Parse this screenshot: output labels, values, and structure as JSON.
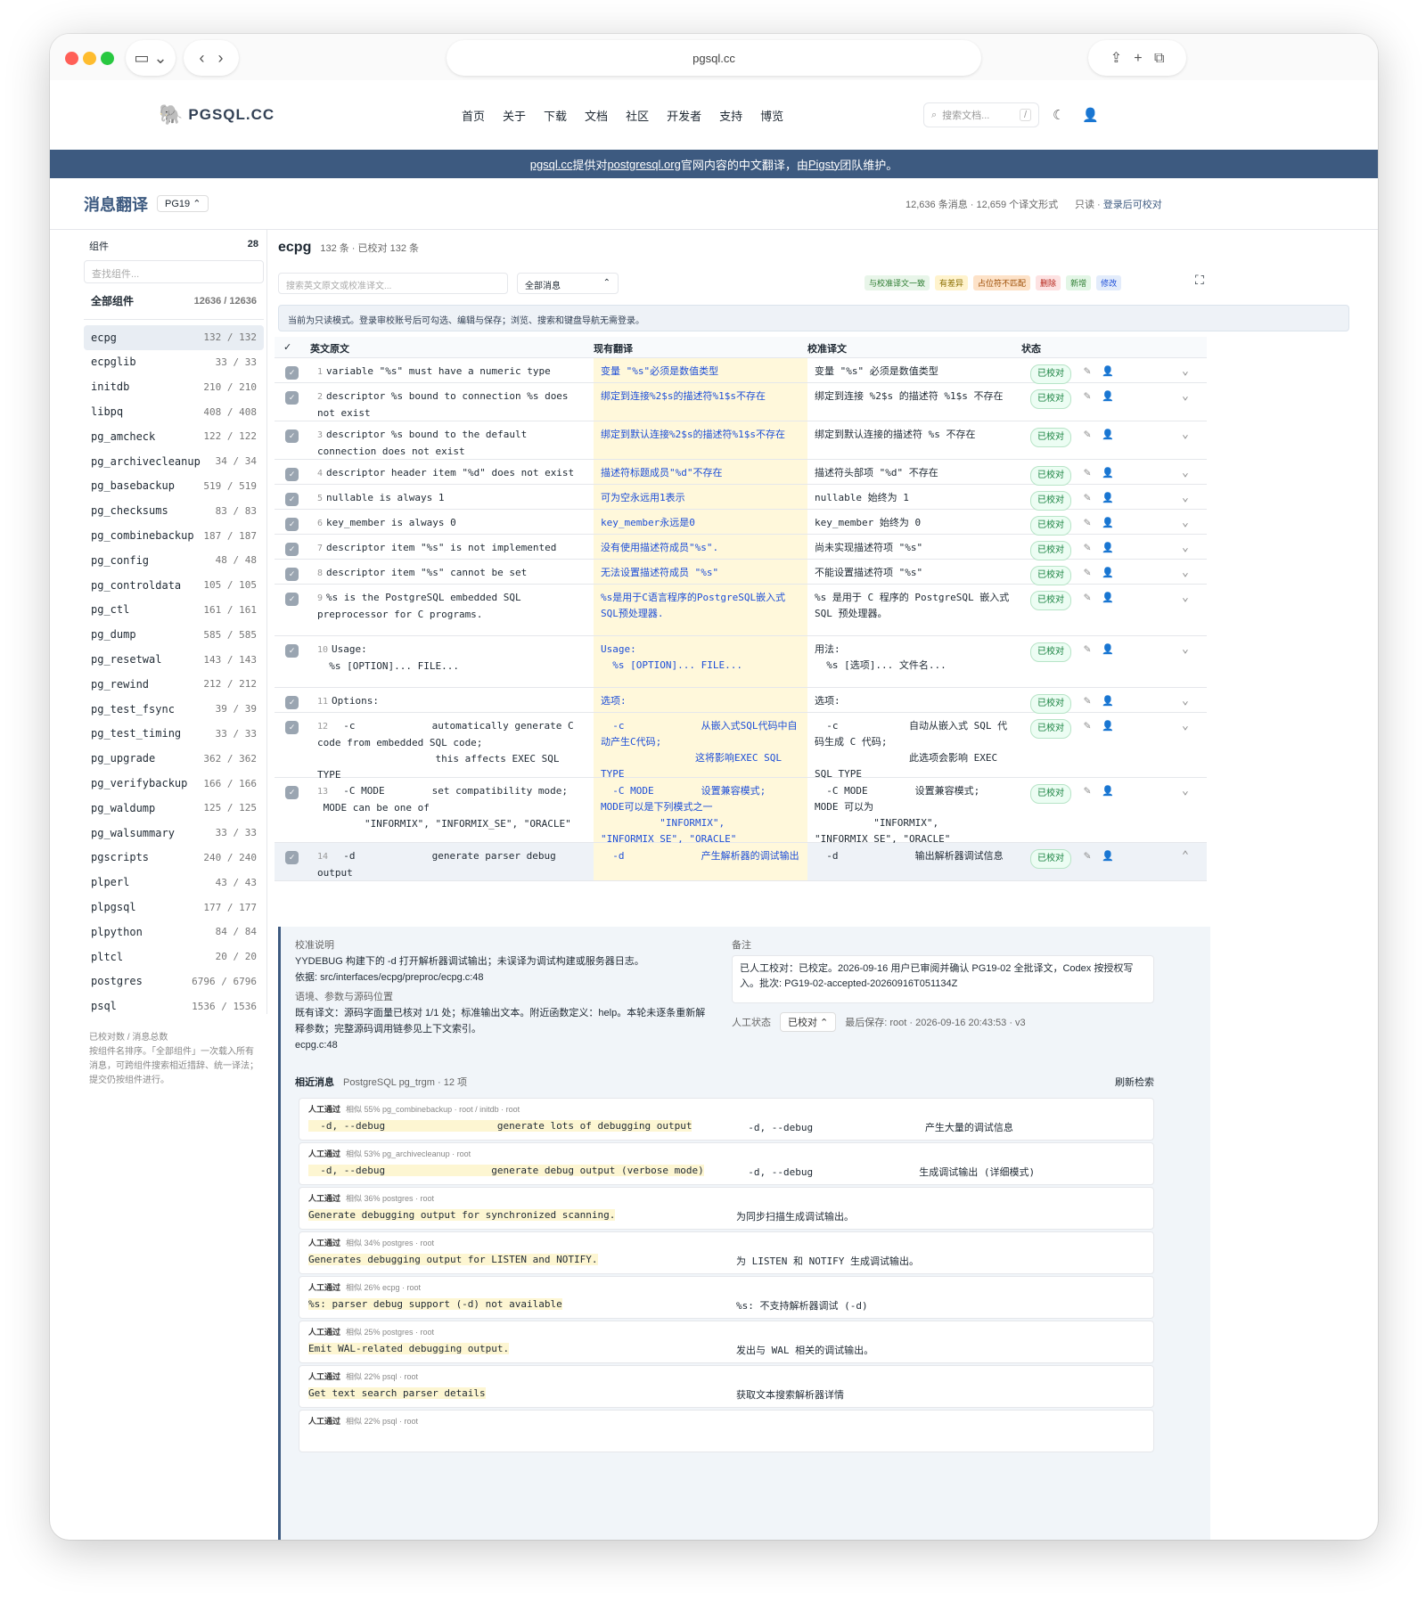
{
  "browser": {
    "url": "pgsql.cc"
  },
  "site": {
    "logo": "PGSQL.CC",
    "nav": [
      "首页",
      "关于",
      "下载",
      "文档",
      "社区",
      "开发者",
      "支持",
      "博览"
    ],
    "search_placeholder": "搜索文档...",
    "search_key": "/"
  },
  "banner": {
    "p1": "pgsql.cc",
    "p2": " 提供对 ",
    "p3": "postgresql.org",
    "p4": " 官网内容的中文翻译，由 ",
    "p5": "Pigsty",
    "p6": " 团队维护。"
  },
  "page": {
    "title": "消息翻译",
    "version": "PG19",
    "stats": "12,636 条消息 · 12,659 个译文形式",
    "readonly": "只读 · ",
    "login": "登录后可校对"
  },
  "sidebar": {
    "heading": "组件",
    "count": "28",
    "filter_placeholder": "查找组件...",
    "all_label": "全部组件",
    "all_count": "12636 / 12636",
    "items": [
      [
        "ecpg",
        "132 / 132"
      ],
      [
        "ecpglib",
        "33 / 33"
      ],
      [
        "initdb",
        "210 / 210"
      ],
      [
        "libpq",
        "408 / 408"
      ],
      [
        "pg_amcheck",
        "122 / 122"
      ],
      [
        "pg_archivecleanup",
        "34 / 34"
      ],
      [
        "pg_basebackup",
        "519 / 519"
      ],
      [
        "pg_checksums",
        "83 / 83"
      ],
      [
        "pg_combinebackup",
        "187 / 187"
      ],
      [
        "pg_config",
        "48 / 48"
      ],
      [
        "pg_controldata",
        "105 / 105"
      ],
      [
        "pg_ctl",
        "161 / 161"
      ],
      [
        "pg_dump",
        "585 / 585"
      ],
      [
        "pg_resetwal",
        "143 / 143"
      ],
      [
        "pg_rewind",
        "212 / 212"
      ],
      [
        "pg_test_fsync",
        "39 / 39"
      ],
      [
        "pg_test_timing",
        "33 / 33"
      ],
      [
        "pg_upgrade",
        "362 / 362"
      ],
      [
        "pg_verifybackup",
        "166 / 166"
      ],
      [
        "pg_waldump",
        "125 / 125"
      ],
      [
        "pg_walsummary",
        "33 / 33"
      ],
      [
        "pgscripts",
        "240 / 240"
      ],
      [
        "plperl",
        "43 / 43"
      ],
      [
        "plpgsql",
        "177 / 177"
      ],
      [
        "plpython",
        "84 / 84"
      ],
      [
        "pltcl",
        "20 / 20"
      ],
      [
        "postgres",
        "6796 / 6796"
      ],
      [
        "psql",
        "1536 / 1536"
      ]
    ],
    "note_title": "已校对数 / 消息总数",
    "note": "按组件名排序。「全部组件」一次载入所有消息，可跨组件搜索相近措辞、统一译法；提交仍按组件进行。"
  },
  "main": {
    "component": "ecpg",
    "summary": "132 条 · 已校对 132 条",
    "search_placeholder": "搜索英文原文或校准译文...",
    "filter": "全部消息",
    "legend": [
      "与校准译文一致",
      "有差异",
      "占位符不匹配",
      "删除",
      "新增",
      "修改"
    ],
    "notice": "当前为只读模式。登录审校账号后可勾选、编辑与保存；浏览、搜索和键盘导航无需登录。",
    "cols": [
      "英文原文",
      "现有翻译",
      "校准译文",
      "状态"
    ],
    "rows": [
      {
        "n": "1",
        "en": "variable \"%s\" must have a numeric type",
        "cur": "变量 \"%s\"必须是数值类型",
        "cal": "变量 \"%s\" 必须是数值类型",
        "h": 25
      },
      {
        "n": "2",
        "en": "descriptor %s bound to connection %s does not exist",
        "cur": "绑定到连接%2$s的描述符%1$s不存在",
        "cal": "绑定到连接 %2$s 的描述符 %1$s 不存在",
        "h": 40
      },
      {
        "n": "3",
        "en": "descriptor %s bound to the default connection does not exist",
        "cur": "绑定到默认连接%2$s的描述符%1$s不存在",
        "cal": "绑定到默认连接的描述符 %s 不存在",
        "h": 40
      },
      {
        "n": "4",
        "en": "descriptor header item \"%d\" does not exist",
        "cur": "描述符标题成员\"%d\"不存在",
        "cal": "描述符头部项 \"%d\" 不存在",
        "h": 25
      },
      {
        "n": "5",
        "en": "nullable is always 1",
        "cur": "可为空永远用1表示",
        "cal": "nullable 始终为 1",
        "h": 25
      },
      {
        "n": "6",
        "en": "key_member is always 0",
        "cur": "key_member永远是0",
        "cal": "key_member 始终为 0",
        "h": 25
      },
      {
        "n": "7",
        "en": "descriptor item \"%s\" is not implemented",
        "cur": "没有使用描述符成员\"%s\".",
        "cal": "尚未实现描述符项 \"%s\"",
        "h": 25
      },
      {
        "n": "8",
        "en": "descriptor item \"%s\" cannot be set",
        "cur": "无法设置描述符成员 \"%s\"",
        "cal": "不能设置描述符项 \"%s\"",
        "h": 25
      },
      {
        "n": "9",
        "en": "%s is the PostgreSQL embedded SQL preprocessor for C programs.",
        "cur": "%s是用于C语言程序的PostgreSQL嵌入式SQL预处理器.",
        "cal": "%s 是用于 C 程序的 PostgreSQL 嵌入式 SQL 预处理器。",
        "h": 55
      },
      {
        "n": "10",
        "en": "Usage:\n  %s [OPTION]... FILE...",
        "cur": "Usage:\n  %s [OPTION]... FILE...",
        "cal": "用法:\n  %s [选项]... 文件名...",
        "h": 55
      },
      {
        "n": "11",
        "en": "Options:",
        "cur": "选项:",
        "cal": "选项:",
        "h": 25
      },
      {
        "n": "12",
        "en": "  -c             automatically generate C code from embedded SQL code;\n                    this affects EXEC SQL TYPE",
        "cur": "  -c             从嵌入式SQL代码中自动产生C代码;\n                这将影响EXEC SQL TYPE",
        "cal": "  -c            自动从嵌入式 SQL 代码生成 C 代码;\n                此选项会影响 EXEC SQL TYPE",
        "h": 70
      },
      {
        "n": "13",
        "en": "  -C MODE        set compatibility mode;\n MODE can be one of\n        \"INFORMIX\", \"INFORMIX_SE\", \"ORACLE\"",
        "cur": "  -C MODE        设置兼容模式;\nMODE可以是下列模式之一\n          \"INFORMIX\", \"INFORMIX_SE\", \"ORACLE\"",
        "cal": "  -C MODE        设置兼容模式;\nMODE 可以为\n          \"INFORMIX\", \"INFORMIX_SE\", \"ORACLE\"",
        "h": 70
      },
      {
        "n": "14",
        "en": "  -d             generate parser debug output",
        "cur": "  -d             产生解析器的调试输出",
        "cal": "  -d             输出解析器调试信息",
        "h": 40
      }
    ],
    "status": "已校对"
  },
  "detail": {
    "note_title": "校准说明",
    "note": "YYDEBUG 构建下的 -d 打开解析器调试输出；未误译为调试构建或服务器日志。",
    "basis": "依据: src/interfaces/ecpg/preproc/ecpg.c:48",
    "ctx_title": "语境、参数与源码位置",
    "ctx": "既有译文：源码字面量已核对 1/1 处；标准输出文本。附近函数定义：help。本轮未逐条重新解释参数；完整源码调用链参见上下文索引。",
    "ctx_loc": "ecpg.c:48",
    "remark_title": "备注",
    "remark": "已人工校对：已校定。2026-09-16 用户已审阅并确认 PG19-02 全批译文，Codex 按授权写入。批次: PG19-02-accepted-20260916T051134Z",
    "state_label": "人工状态",
    "state": "已校对",
    "saved": "最后保存: root · 2026-09-16 20:43:53 · v3",
    "similar_title": "相近消息",
    "similar_sub": "PostgreSQL pg_trgm · 12 项",
    "refresh": "刷新检索",
    "similar": [
      {
        "tag": "人工通过",
        "meta": "相似 55%  pg_combinebackup · root / initdb · root",
        "en": "  -d, --debug                   generate lots of debugging output",
        "zh": "  -d, --debug                   产生大量的调试信息"
      },
      {
        "tag": "人工通过",
        "meta": "相似 53%  pg_archivecleanup · root",
        "en": "  -d, --debug                  generate debug output (verbose mode)",
        "zh": "  -d, --debug                  生成调试输出 (详细模式)"
      },
      {
        "tag": "人工通过",
        "meta": "相似 36%  postgres · root",
        "en": "Generate debugging output for synchronized scanning.",
        "zh": "为同步扫描生成调试输出。"
      },
      {
        "tag": "人工通过",
        "meta": "相似 34%  postgres · root",
        "en": "Generates debugging output for LISTEN and NOTIFY.",
        "zh": "为 LISTEN 和 NOTIFY 生成调试输出。"
      },
      {
        "tag": "人工通过",
        "meta": "相似 26%  ecpg · root",
        "en": "%s: parser debug support (-d) not available",
        "zh": "%s: 不支持解析器调试 (-d)"
      },
      {
        "tag": "人工通过",
        "meta": "相似 25%  postgres · root",
        "en": "Emit WAL-related debugging output.",
        "zh": "发出与 WAL 相关的调试输出。"
      },
      {
        "tag": "人工通过",
        "meta": "相似 22%  psql · root",
        "en": "Get text search parser details",
        "zh": "获取文本搜索解析器详情"
      },
      {
        "tag": "人工通过",
        "meta": "相似 22%  psql · root",
        "en": "",
        "zh": ""
      }
    ]
  }
}
